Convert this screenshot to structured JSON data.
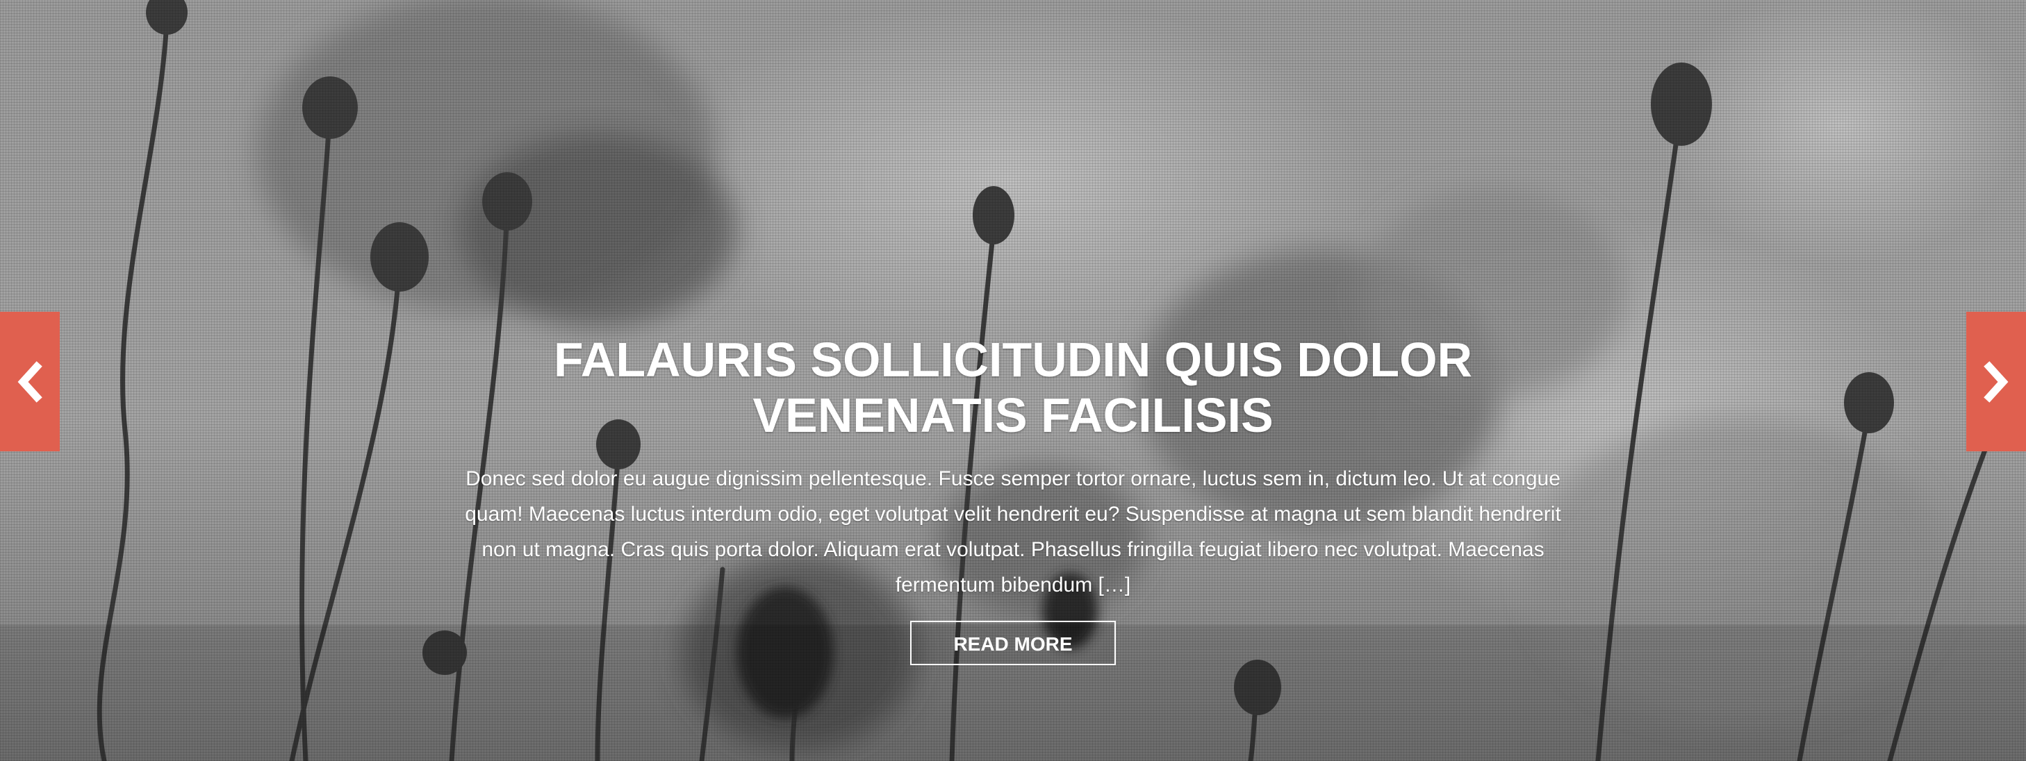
{
  "slide": {
    "title": "FALAURIS SOLLICITUDIN QUIS DOLOR VENENATIS FACILISIS",
    "excerpt": "Donec sed dolor eu augue dignissim pellentesque. Fusce semper tortor ornare, luctus sem in, dictum leo. Ut at congue quam! Maecenas luctus interdum odio, eget volutpat velit hendrerit eu? Suspendisse at magna ut sem blandit hendrerit non ut magna. Cras quis porta dolor. Aliquam erat volutpat. Phasellus fringilla feugiat libero nec volutpat. Maecenas fermentum bibendum […]",
    "read_more_label": "READ MORE",
    "background": "monochrome-poppy-field-photo"
  },
  "nav": {
    "prev_icon": "chevron-left-icon",
    "next_icon": "chevron-right-icon"
  },
  "colors": {
    "accent": "#e0604f",
    "text": "#ffffff"
  }
}
